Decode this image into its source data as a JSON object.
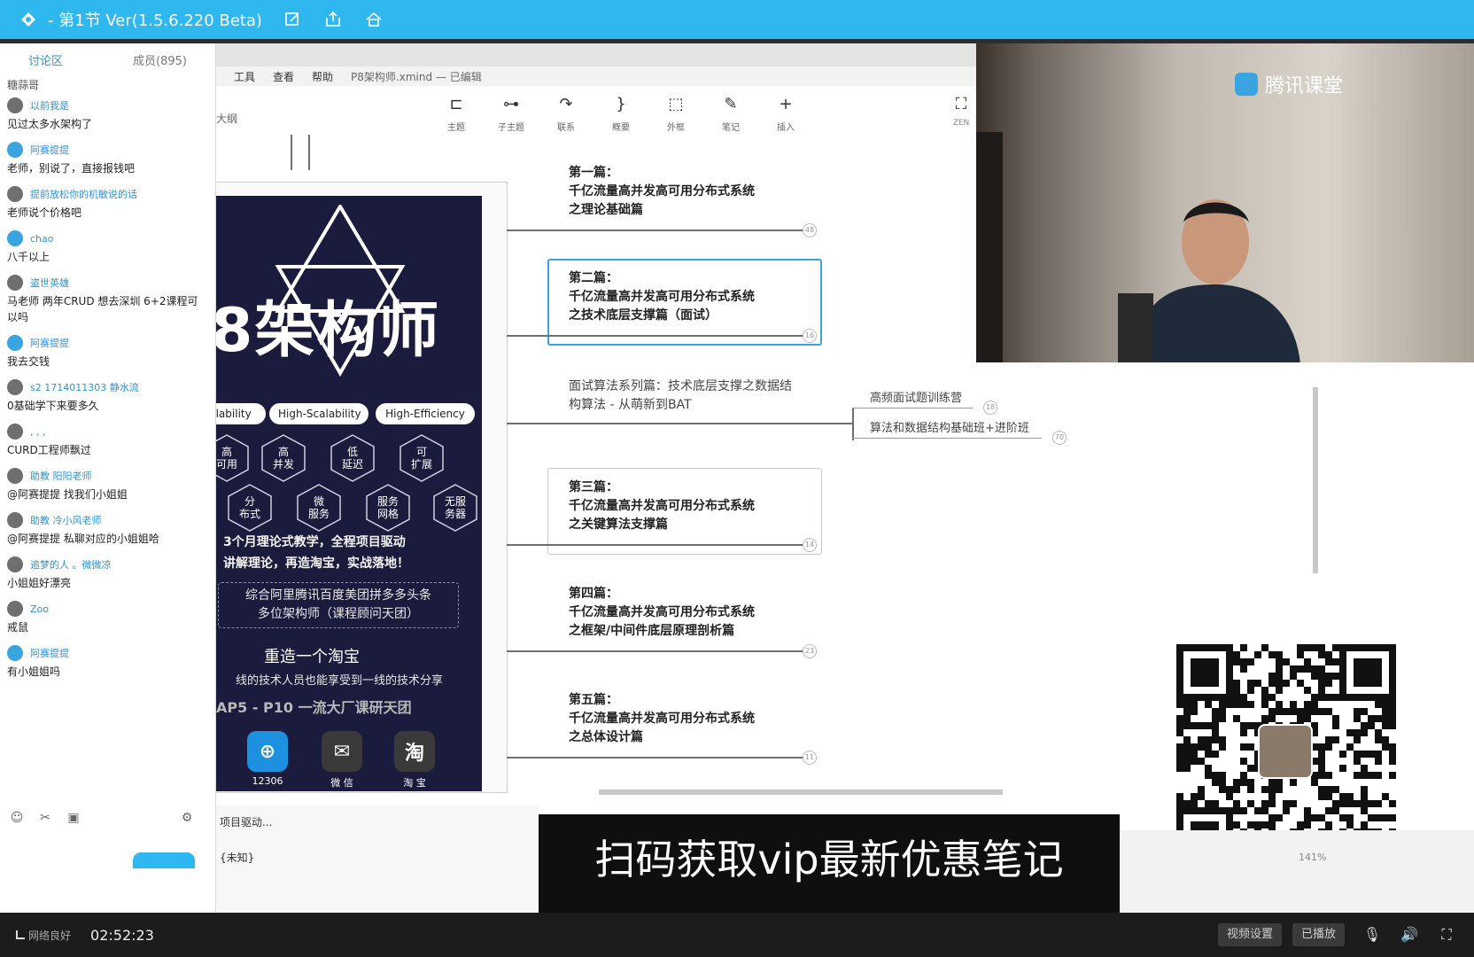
{
  "window": {
    "title": "- 第1节 Ver(1.5.6.220 Beta)"
  },
  "sidebar": {
    "tab_chat": "讨论区",
    "tab_members": "成员(895)",
    "system_message": "糖蒜哥",
    "messages": [
      {
        "name": "以前我是",
        "text": "见过太多水架构了",
        "avatar": "gray"
      },
      {
        "name": "阿赛提提",
        "text": "老师，别说了，直接报钱吧",
        "avatar": "blue"
      },
      {
        "name": "提前放松你的机敏说的话",
        "text": "老师说个价格吧",
        "avatar": "gray"
      },
      {
        "name": "chao",
        "text": "八千以上",
        "avatar": "blue"
      },
      {
        "name": "盗世英雄",
        "text": "马老师 两年CRUD 想去深圳 6+2课程可以吗",
        "avatar": "gray"
      },
      {
        "name": "阿赛提提",
        "text": "我去交钱",
        "avatar": "blue"
      },
      {
        "name": "s2 1714011303 静水流",
        "text": "0基础学下来要多久",
        "avatar": "gray"
      },
      {
        "name": ", , ,",
        "text": "CURD工程师飘过",
        "avatar": "gray"
      },
      {
        "name": "助教 阳阳老师",
        "text": "@阿赛提提 找我们小姐姐",
        "avatar": "gray"
      },
      {
        "name": "助教 冷小风老师",
        "text": "@阿赛提提 私聊对应的小姐姐哈",
        "avatar": "gray"
      },
      {
        "name": "追梦的人 。微微凉",
        "text": "小姐姐好漂亮",
        "avatar": "gray"
      },
      {
        "name": "Zoo",
        "text": "戒鼠",
        "avatar": "gray"
      },
      {
        "name": "阿赛提提",
        "text": "有小姐姐吗",
        "avatar": "blue"
      }
    ]
  },
  "xmind": {
    "menu": [
      "工具",
      "查看",
      "帮助"
    ],
    "file_name": "P8架构师.xmind — 已编辑",
    "outline": "大纲",
    "toolbar": [
      {
        "label": "主题",
        "icon": "topic-icon",
        "glyph": "⊏"
      },
      {
        "label": "子主题",
        "icon": "subtopic-icon",
        "glyph": "⊶"
      },
      {
        "label": "联系",
        "icon": "relationship-icon",
        "glyph": "↷"
      },
      {
        "label": "概要",
        "icon": "summary-icon",
        "glyph": "}"
      },
      {
        "label": "外框",
        "icon": "boundary-icon",
        "glyph": "⬚"
      },
      {
        "label": "笔记",
        "icon": "note-icon",
        "glyph": "✎"
      },
      {
        "label": "插入",
        "icon": "insert-icon",
        "glyph": "+"
      }
    ],
    "zen_label": "ZEN",
    "topics": [
      {
        "text": "第一篇：\n千亿流量高并发高可用分布式系统\n之理论基础篇",
        "knob": "48"
      },
      {
        "text": "第二篇：\n千亿流量高并发高可用分布式系统\n之技术底层支撑篇（面试）",
        "knob": "16"
      },
      {
        "text": "面试算法系列篇：技术底层支撑之数据结\n构算法 - 从萌新到BAT",
        "knob": ""
      },
      {
        "text": "第三篇：\n千亿流量高并发高可用分布式系统\n之关键算法支撑篇",
        "knob": "14"
      },
      {
        "text": "第四篇：\n千亿流量高并发高可用分布式系统\n之框架/中间件底层原理剖析篇",
        "knob": "23"
      },
      {
        "text": "第五篇：\n千亿流量高并发高可用分布式系统\n之总体设计篇",
        "knob": "11"
      }
    ],
    "subtopics": [
      {
        "text": "高频面试题训练营",
        "knob": "18"
      },
      {
        "text": "算法和数据结构基础班+进阶班",
        "knob": "70"
      }
    ],
    "zoom": "141%"
  },
  "poster": {
    "hero": "8架构师",
    "pills": [
      "ilability",
      "High-Scalability",
      "High-Efficiency"
    ],
    "hexes": [
      "高\n可用",
      "高\n并发",
      "低\n延迟",
      "可\n扩展",
      "分\n布式",
      "微\n服务",
      "服务\n网格",
      "无服\n务器"
    ],
    "line1": "3个月理论式教学，全程项目驱动",
    "line2": "讲解理论，再造淘宝，实战落地！",
    "dash_text": "综合阿里腾讯百度美团拼多多头条\n多位架构师（课程顾问天团）",
    "rebuild": "重造一个淘宝",
    "share": "线的技术人员也能享受到一线的技术分享",
    "rank": "AP5 - P10 一流大厂课研天团",
    "apps": [
      {
        "glyph": "⊕",
        "label": "12306",
        "color": "#1e90e0"
      },
      {
        "glyph": "✉",
        "label": "微 信",
        "color": "#3a3a3a"
      },
      {
        "glyph": "淘",
        "label": "淘 宝",
        "color": "#3a3a3a"
      }
    ],
    "bottom_file": "项目驱动...",
    "bottom_file2": "{未知}"
  },
  "video": {
    "brand": "腾讯课堂"
  },
  "caption": "扫码获取vip最新优惠笔记",
  "bottombar": {
    "network": "网络良好",
    "time": "02:52:23",
    "video_settings": "视频设置",
    "self_view": "已播放"
  },
  "colors": {
    "titlebar": "#2fb7f0",
    "accent_blue": "#3aa4e0",
    "poster_bg": "#1b1b3d"
  }
}
